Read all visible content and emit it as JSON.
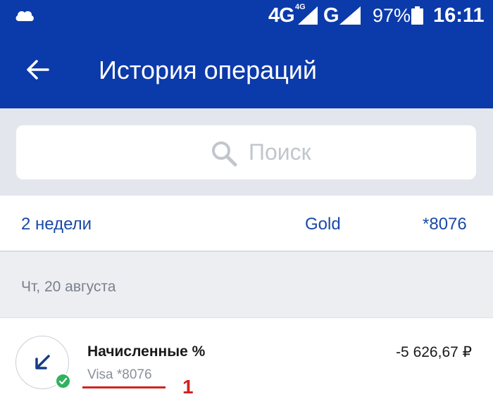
{
  "status_bar": {
    "network_1": "4G",
    "network_1_badge": "4G",
    "network_2": "G",
    "battery": "97%",
    "time": "16:11"
  },
  "app_bar": {
    "title": "История операций"
  },
  "search": {
    "placeholder": "Поиск"
  },
  "filters": {
    "period": "2 недели",
    "product": "Gold",
    "card": "*8076"
  },
  "transactions": {
    "date": "Чт, 20 августа",
    "items": [
      {
        "title": "Начисленные %",
        "subtitle": "Visa *8076",
        "amount": "-5 626,67 ₽",
        "status": "completed"
      }
    ]
  },
  "annotation": {
    "marker": "1",
    "color": "#d22222"
  },
  "colors": {
    "primary": "#0b3aaa",
    "link": "#1a4aa6",
    "success": "#30b25f"
  }
}
